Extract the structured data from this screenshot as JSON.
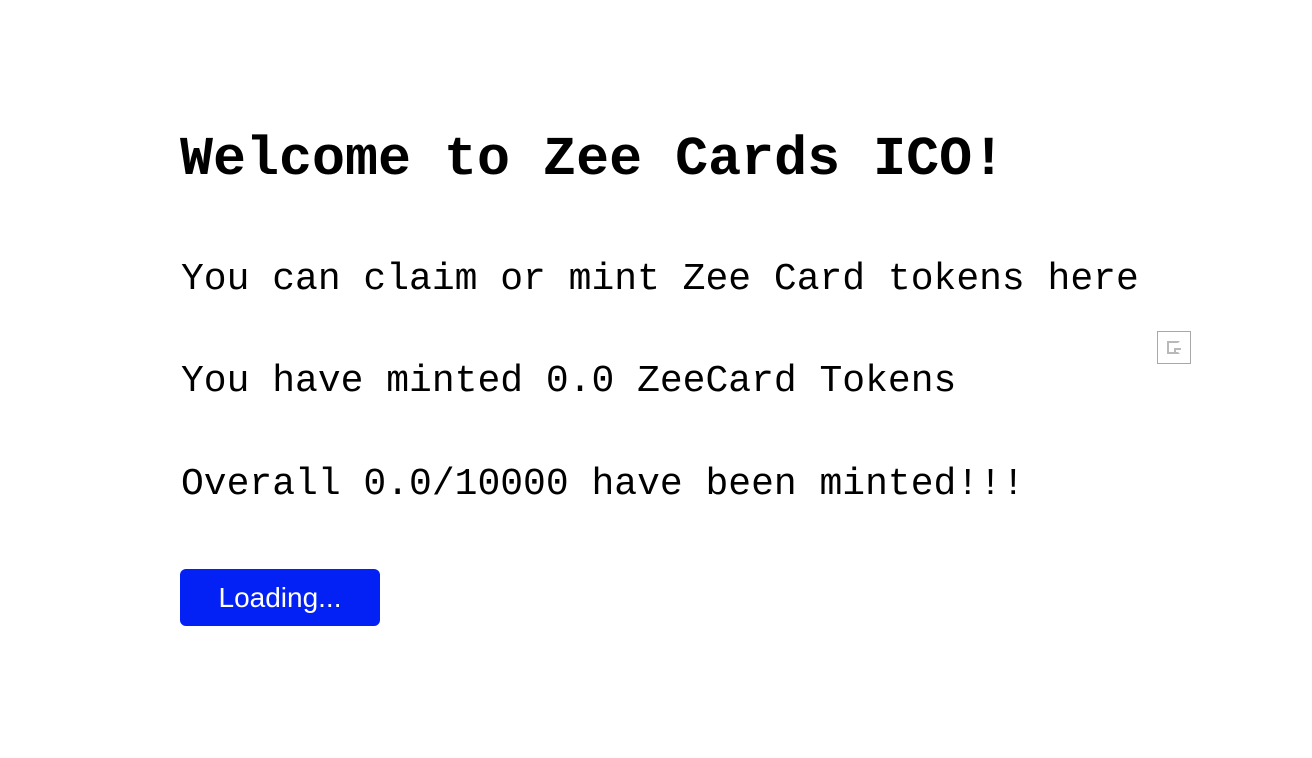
{
  "header": {
    "title": "Welcome to Zee Cards ICO!"
  },
  "main": {
    "intro": "You can claim or mint Zee Card tokens here",
    "user_minted": "You have minted 0.0 ZeeCard Tokens",
    "overall_minted": "Overall 0.0/10000 have been minted!!!",
    "action_button_label": "Loading..."
  },
  "image": {
    "icon": "broken-image-icon"
  },
  "colors": {
    "button_background": "#0320f5",
    "button_text": "#ffffff",
    "text": "#000000",
    "background": "#ffffff"
  }
}
